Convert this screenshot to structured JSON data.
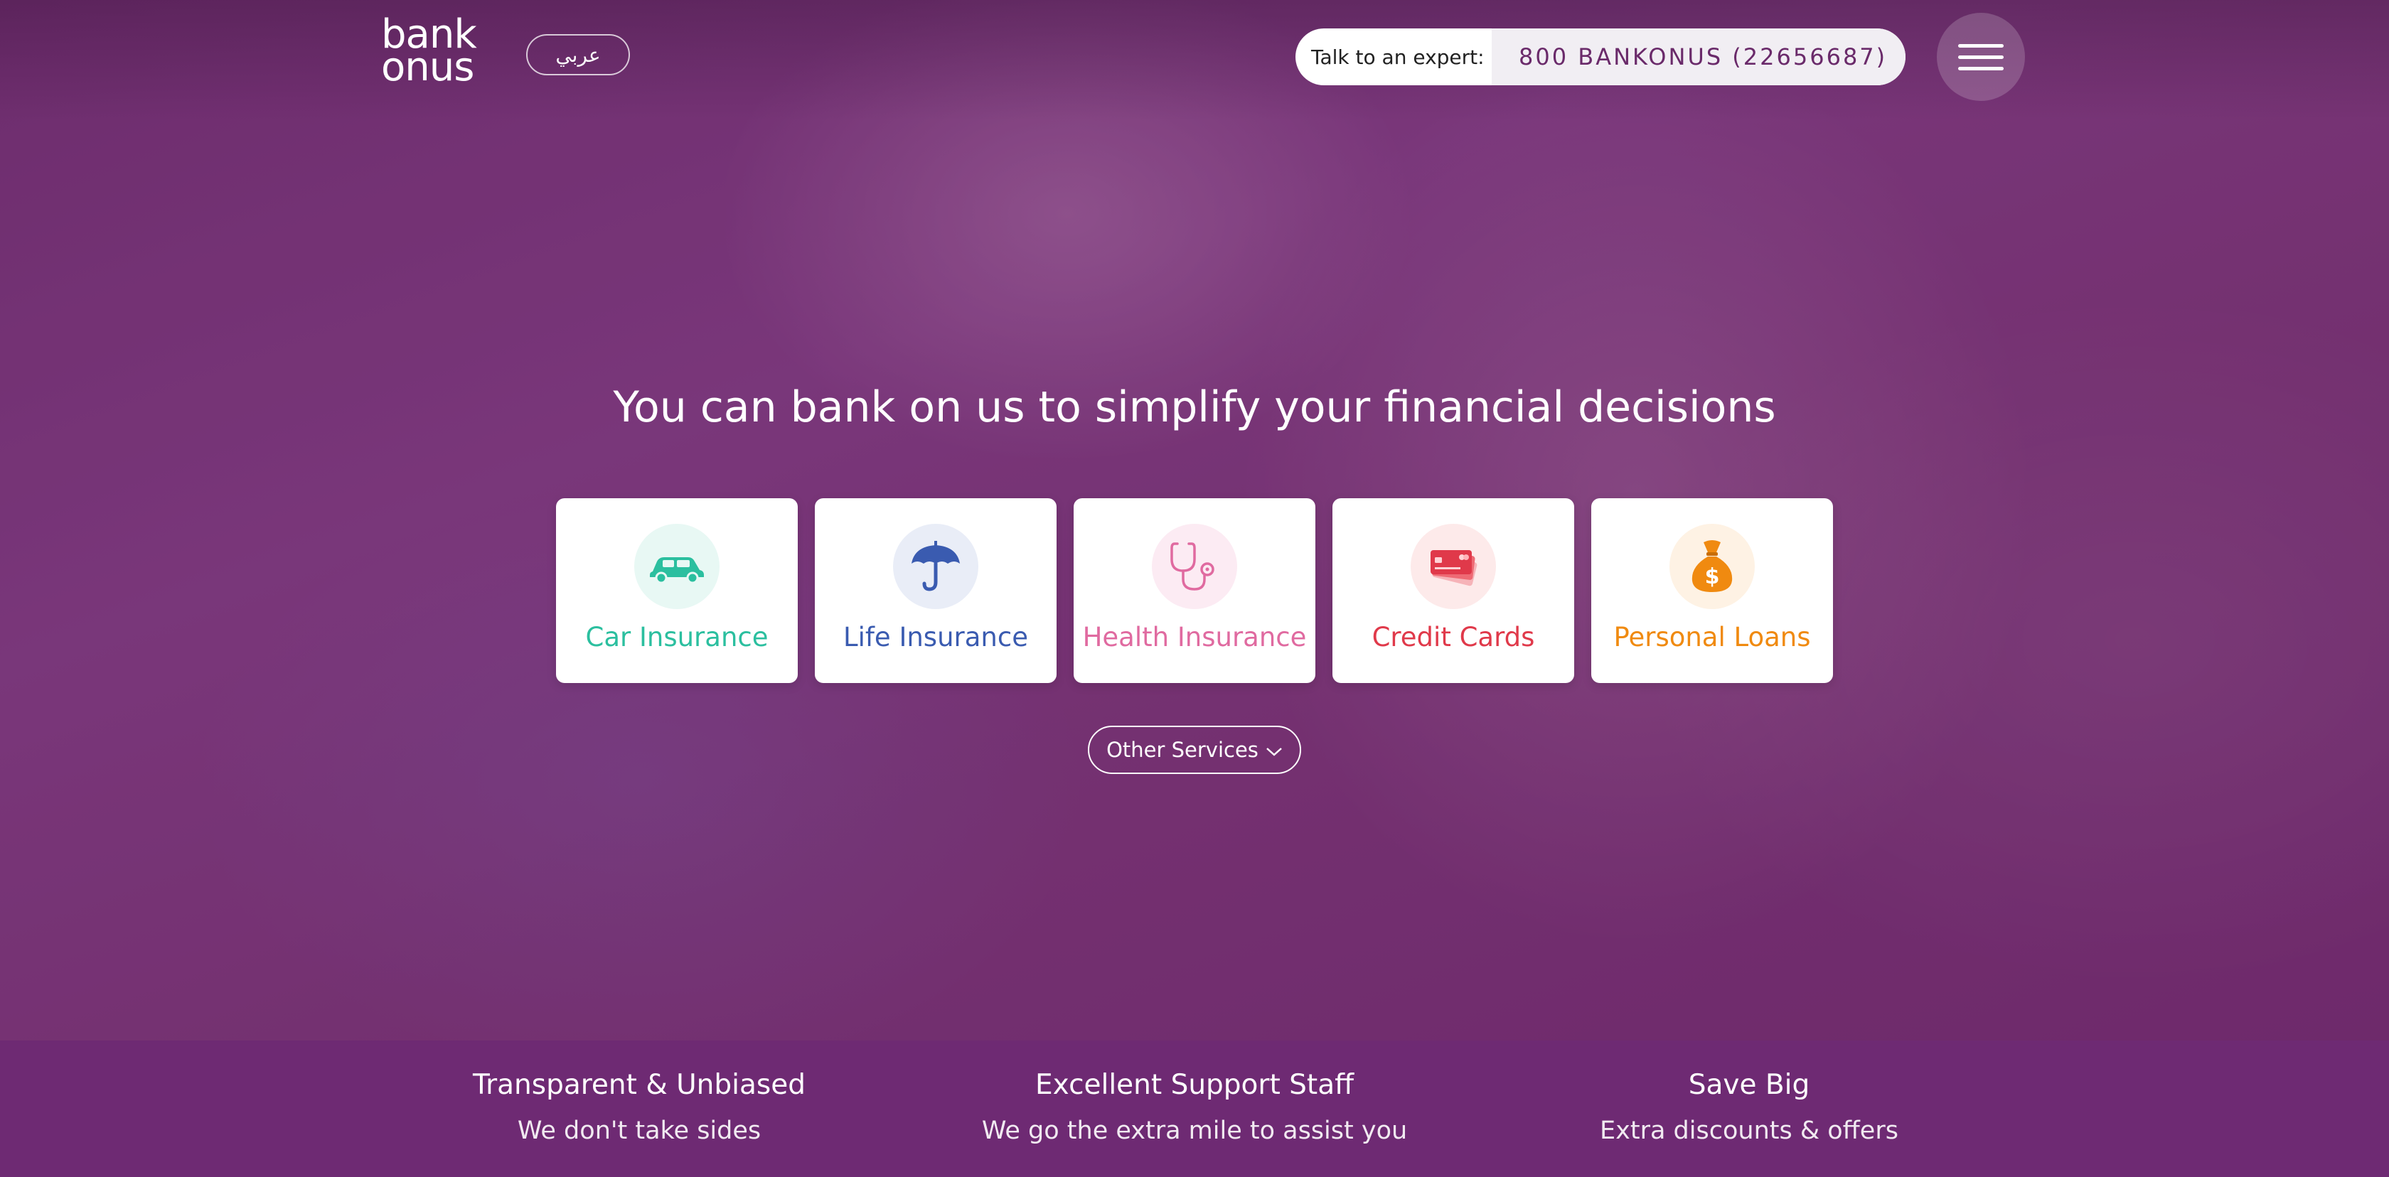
{
  "header": {
    "logo_line1": "bank",
    "logo_line2": "onus",
    "language_label": "عربي",
    "expert_label": "Talk to an expert:",
    "expert_phone": "800 BANKONUS (22656687)",
    "menu_icon": "hamburger-icon"
  },
  "hero": {
    "headline": "You can bank on us to simplify your financial decisions"
  },
  "products": [
    {
      "label": "Car Insurance",
      "icon": "car-icon",
      "color": "#2bbf9f",
      "bg": "#e8f8f4"
    },
    {
      "label": "Life Insurance",
      "icon": "umbrella-icon",
      "color": "#3a5bb0",
      "bg": "#e9edf7"
    },
    {
      "label": "Health Insurance",
      "icon": "stethoscope-icon",
      "color": "#e06aa0",
      "bg": "#fcebf3"
    },
    {
      "label": "Credit Cards",
      "icon": "credit-card-icon",
      "color": "#e0394a",
      "bg": "#fdeaea"
    },
    {
      "label": "Personal Loans",
      "icon": "money-bag-icon",
      "color": "#f08a10",
      "bg": "#fef2e4"
    }
  ],
  "other_services": {
    "label": "Other Services",
    "icon": "chevron-down-icon"
  },
  "features": [
    {
      "title": "Transparent & Unbiased",
      "subtitle": "We don't take sides"
    },
    {
      "title": "Excellent Support Staff",
      "subtitle": "We go the extra mile to assist you"
    },
    {
      "title": "Save Big",
      "subtitle": "Extra discounts & offers"
    }
  ],
  "colors": {
    "brand_purple": "#6e2a73",
    "phone_text": "#6a2a6a"
  }
}
